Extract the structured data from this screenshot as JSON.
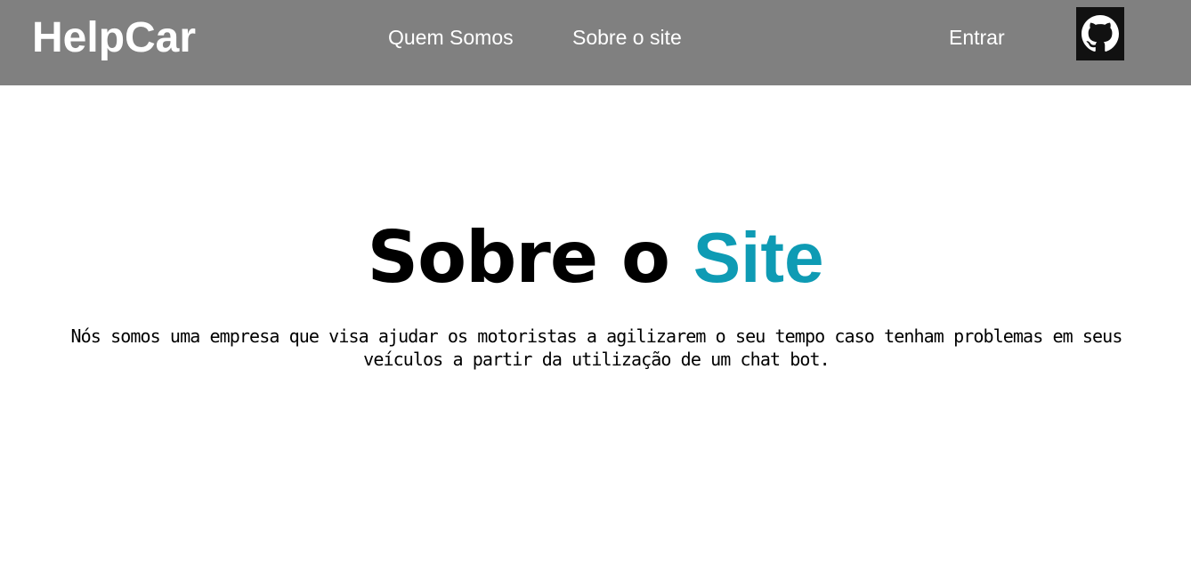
{
  "header": {
    "brand": "HelpCar",
    "nav": {
      "quem_somos": "Quem Somos",
      "sobre_site": "Sobre o site",
      "entrar": "Entrar"
    },
    "github_icon": "github-icon"
  },
  "main": {
    "heading_part1": "Sobre o ",
    "heading_part2": "Site",
    "description": "Nós somos uma empresa que visa ajudar os motoristas a agilizarem o seu tempo caso tenham problemas em seus veículos a partir da utilização de um chat bot."
  },
  "colors": {
    "header_bg": "#808080",
    "accent": "#0e9bb4",
    "github_bg": "#111111"
  }
}
